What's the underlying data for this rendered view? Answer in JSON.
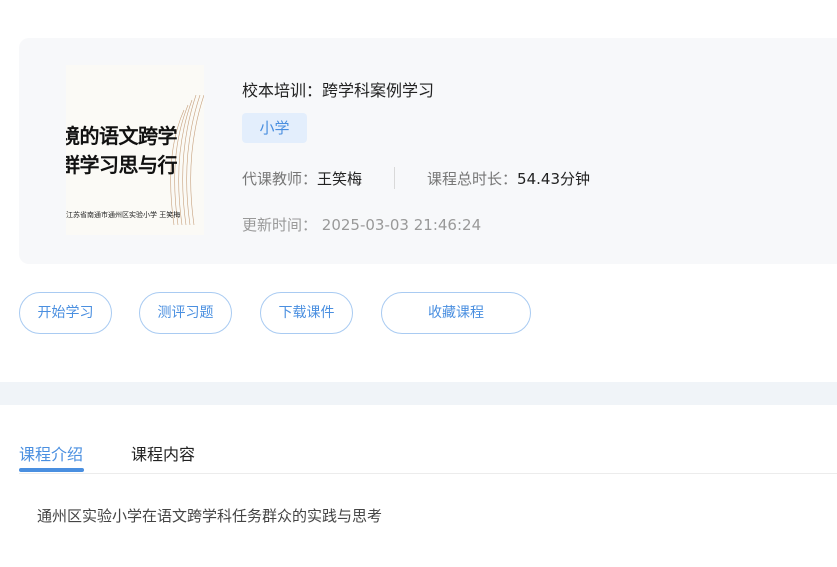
{
  "course": {
    "cover": {
      "title_line1": "境的语文跨学",
      "title_line2": "群学习思与行",
      "footer": "江苏省南通市通州区实验小学  王笑梅"
    },
    "title": "校本培训：跨学科案例学习",
    "level_tag": "小学",
    "teacher_label": "代课教师：",
    "teacher_name": "王笑梅",
    "duration_label": "课程总时长：",
    "duration_value": "54.43分钟",
    "updated_label": "更新时间：",
    "updated_value": "2025-03-03 21:46:24"
  },
  "actions": {
    "start": "开始学习",
    "quiz": "测评习题",
    "download": "下载课件",
    "favorite": "收藏课程"
  },
  "tabs": {
    "intro": "课程介绍",
    "content": "课程内容"
  },
  "intro_text": "通州区实验小学在语文跨学科任务群众的实践与思考",
  "colors": {
    "accent": "#4a8fe0",
    "card_bg": "#f7f8fa",
    "tag_bg": "#e3eefc"
  }
}
